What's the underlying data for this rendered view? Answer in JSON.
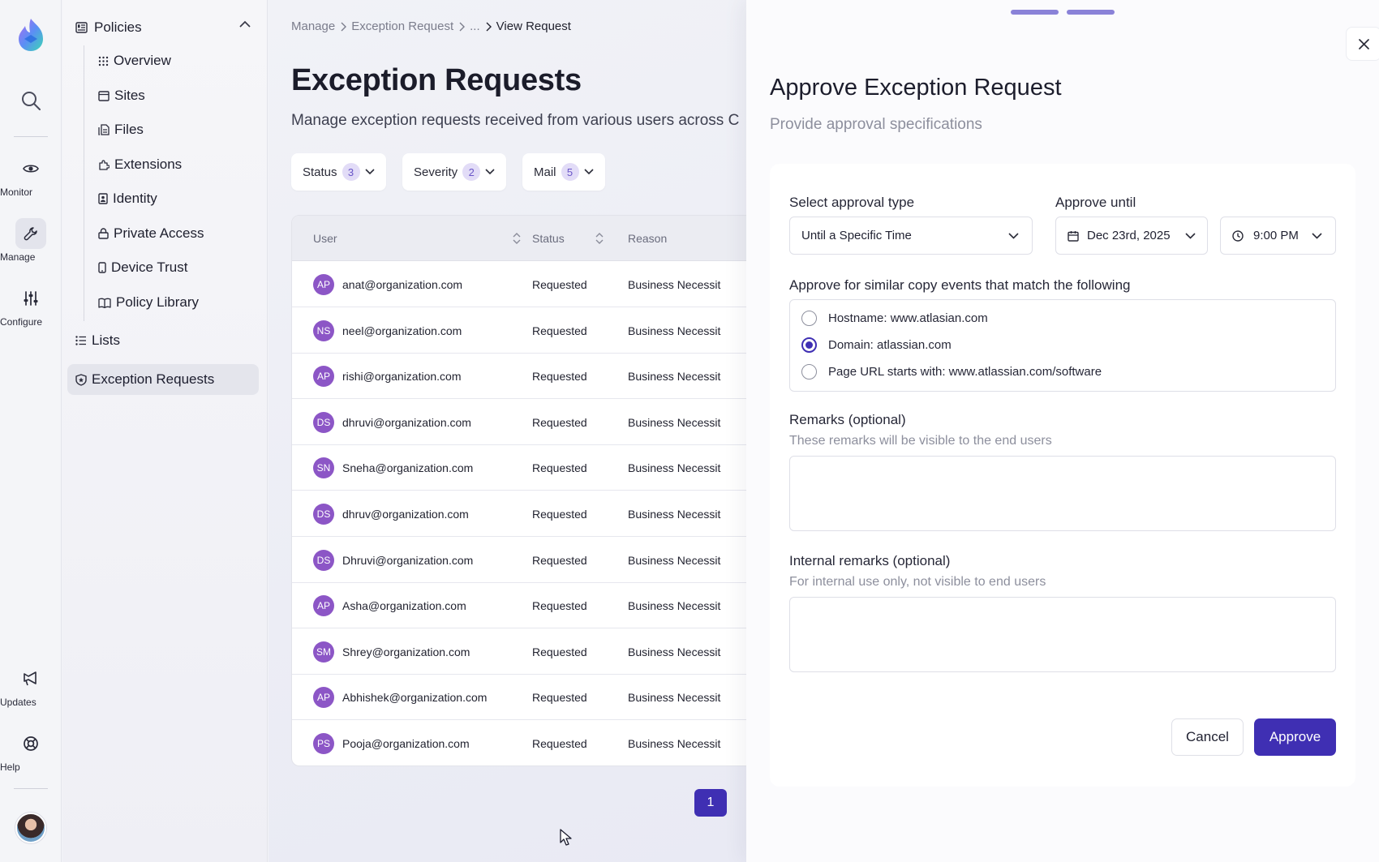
{
  "rail": {
    "items": [
      {
        "label": "Monitor",
        "icon": "eye-icon"
      },
      {
        "label": "Manage",
        "icon": "wrench-icon"
      },
      {
        "label": "Configure",
        "icon": "sliders-icon"
      },
      {
        "label": "Updates",
        "icon": "megaphone-icon"
      },
      {
        "label": "Help",
        "icon": "lifebuoy-icon"
      }
    ]
  },
  "sidenav": {
    "section": "Policies",
    "items": [
      "Overview",
      "Sites",
      "Files",
      "Extensions",
      "Identity",
      "Private Access",
      "Device Trust",
      "Policy Library"
    ],
    "lists": "Lists",
    "active": "Exception Requests"
  },
  "breadcrumb": {
    "items": [
      "Manage",
      "Exception Request",
      "...",
      "View Request"
    ]
  },
  "page": {
    "title": "Exception Requests",
    "subtitle": "Manage exception requests received from various users across C"
  },
  "filters": [
    {
      "label": "Status",
      "count": "3"
    },
    {
      "label": "Severity",
      "count": "2"
    },
    {
      "label": "Mail",
      "count": "5"
    }
  ],
  "table": {
    "columns": [
      "User",
      "Status",
      "Reason"
    ],
    "rows": [
      {
        "initials": "AP",
        "email": "anat@organization.com",
        "status": "Requested",
        "reason": "Business Necessit"
      },
      {
        "initials": "NS",
        "email": "neel@organization.com",
        "status": "Requested",
        "reason": "Business Necessit"
      },
      {
        "initials": "AP",
        "email": "rishi@organization.com",
        "status": "Requested",
        "reason": "Business Necessit"
      },
      {
        "initials": "DS",
        "email": "dhruvi@organization.com",
        "status": "Requested",
        "reason": "Business Necessit"
      },
      {
        "initials": "SN",
        "email": "Sneha@organization.com",
        "status": "Requested",
        "reason": "Business Necessit"
      },
      {
        "initials": "DS",
        "email": "dhruv@organization.com",
        "status": "Requested",
        "reason": "Business Necessit"
      },
      {
        "initials": "DS",
        "email": "Dhruvi@organization.com",
        "status": "Requested",
        "reason": "Business Necessit"
      },
      {
        "initials": "AP",
        "email": "Asha@organization.com",
        "status": "Requested",
        "reason": "Business Necessit"
      },
      {
        "initials": "SM",
        "email": "Shrey@organization.com",
        "status": "Requested",
        "reason": "Business Necessit"
      },
      {
        "initials": "AP",
        "email": "Abhishek@organization.com",
        "status": "Requested",
        "reason": "Business Necessit"
      },
      {
        "initials": "PS",
        "email": "Pooja@organization.com",
        "status": "Requested",
        "reason": "Business Necessit"
      }
    ]
  },
  "pagination": {
    "current": "1"
  },
  "drawer": {
    "title": "Approve Exception Request",
    "subtitle": "Provide approval specifications",
    "approval_type_label": "Select approval type",
    "approval_type_value": "Until a Specific Time",
    "approve_until_label": "Approve until",
    "date_value": "Dec 23rd, 2025",
    "time_value": "9:00 PM",
    "match_label": "Approve for similar copy events that match the following",
    "options": [
      {
        "label": "Hostname: www.atlasian.com",
        "selected": false
      },
      {
        "label": "Domain: atlassian.com",
        "selected": true
      },
      {
        "label": "Page URL starts with: www.atlassian.com/software",
        "selected": false
      }
    ],
    "remarks_label": "Remarks (optional)",
    "remarks_help": "These remarks will be visible to the end users",
    "remarks_value": "",
    "internal_label": "Internal remarks (optional)",
    "internal_help": "For internal use only, not visible to end users",
    "internal_value": "",
    "cancel_label": "Cancel",
    "approve_label": "Approve"
  },
  "colors": {
    "accent": "#3f2fb3",
    "avatar": "#8c56c6",
    "badge_bg": "#e2dcf7"
  }
}
